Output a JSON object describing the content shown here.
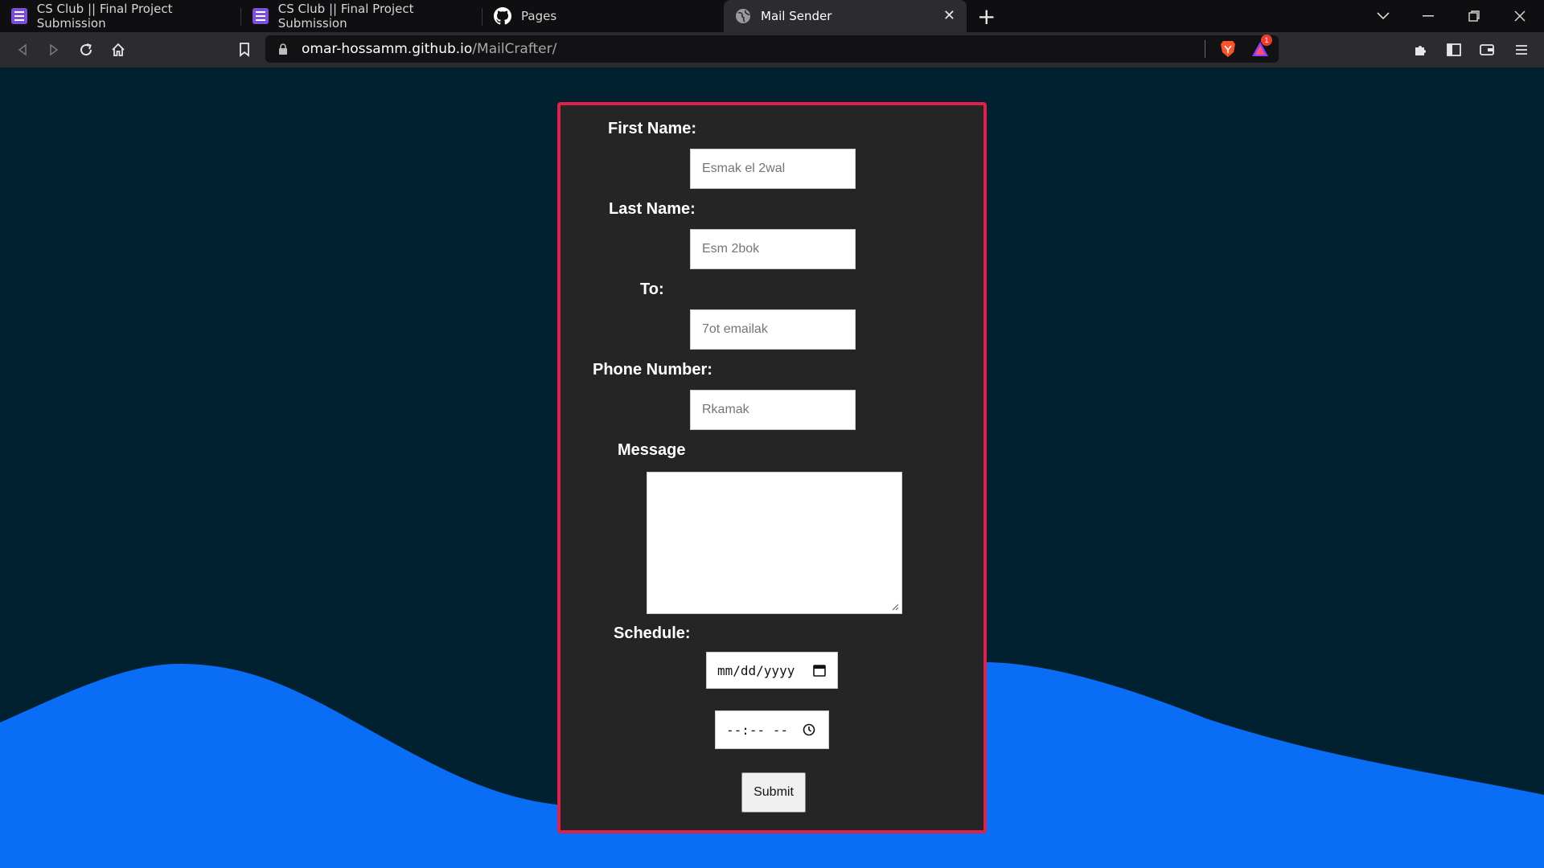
{
  "browser": {
    "tabs": [
      {
        "title": "CS Club || Final Project Submission",
        "icon": "google-forms-icon"
      },
      {
        "title": "CS Club || Final Project Submission",
        "icon": "google-forms-icon"
      },
      {
        "title": "Pages",
        "icon": "github-icon"
      },
      {
        "title": "Mail Sender",
        "icon": "globe-icon",
        "active": true
      }
    ],
    "url_host": "omar-hossamm.github.io",
    "url_path": "/MailCrafter/",
    "notification_count": "1"
  },
  "form": {
    "first_name_label": "First Name:",
    "first_name_placeholder": "Esmak el 2wal",
    "last_name_label": "Last Name:",
    "last_name_placeholder": "Esm 2bok",
    "to_label": "To:",
    "to_placeholder": "7ot emailak",
    "phone_label": "Phone Number:",
    "phone_placeholder": "Rkamak",
    "message_label": "Message",
    "schedule_label": "Schedule:",
    "date_placeholder": "mm/dd/yyyy",
    "time_placeholder": "--:-- --",
    "submit_label": "Submit"
  },
  "colors": {
    "page_background": "#012030",
    "wave": "#0a6df5",
    "card_background": "#252525",
    "card_border": "#e01f4b"
  }
}
